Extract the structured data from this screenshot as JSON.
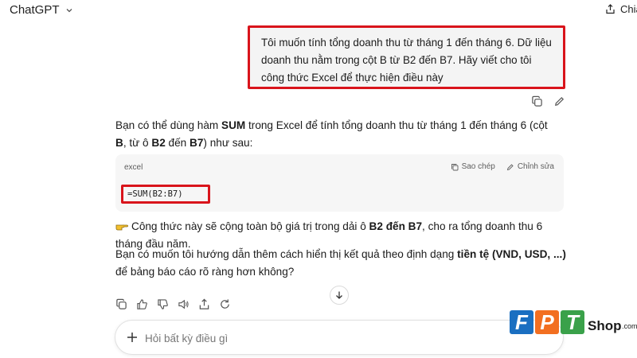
{
  "header": {
    "model_name": "ChatGPT",
    "share_label": "Chia"
  },
  "user_message": {
    "text": "Tôi muốn tính tổng doanh thu từ tháng 1 đến tháng 6. Dữ liệu doanh thu nằm trong cột B từ B2 đến B7. Hãy viết cho tôi công thức Excel để thực hiện điều này"
  },
  "assistant": {
    "p1_a": "Bạn có thể dùng hàm ",
    "p1_b": "SUM",
    "p1_c": " trong Excel để tính tổng doanh thu từ tháng 1 đến tháng 6 (cột ",
    "p1_d": "B",
    "p1_e": ", từ ô ",
    "p1_f": "B2",
    "p1_g": " đến ",
    "p1_h": "B7",
    "p1_i": ") như sau:",
    "code": {
      "lang": "excel",
      "copy_label": "Sao chép",
      "edit_label": "Chỉnh sửa",
      "content": "=SUM(B2:B7)"
    },
    "p2_a": "Công thức này sẽ cộng toàn bộ giá trị trong dải ô ",
    "p2_b": "B2 đến B7",
    "p2_c": ", cho ra tổng doanh thu 6 tháng đầu năm.",
    "p3_a": "Bạn có muốn tôi hướng dẫn thêm cách hiển thị kết quả theo định dạng ",
    "p3_b": "tiền tệ (VND, USD, ...)",
    "p3_c": " để bảng báo cáo rõ ràng hơn không?"
  },
  "composer": {
    "placeholder": "Hỏi bất kỳ điều gì"
  },
  "watermark": {
    "letters": [
      "F",
      "P",
      "T"
    ],
    "shop": "Shop",
    "domain": ".com.vn"
  },
  "colors": {
    "highlight_border": "#d9141b",
    "fpt_blue": "#1a6fc1",
    "fpt_orange": "#f26f21",
    "fpt_green": "#3aa14a"
  }
}
